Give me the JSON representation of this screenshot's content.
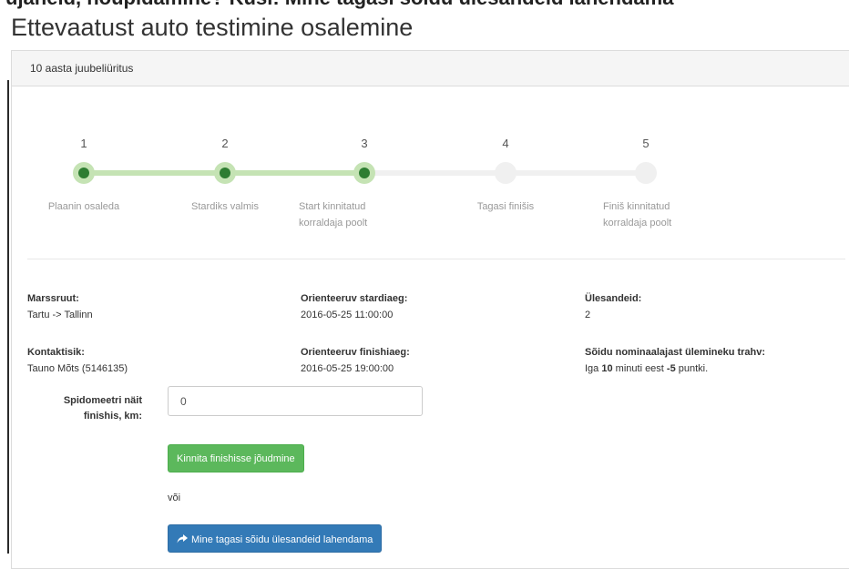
{
  "top_strip": {
    "text": "ujaneid, nõupidamine? Küsi:  Mine tagasi sõidu ülesandeid lahendama"
  },
  "page": {
    "title": "Ettevaatust auto testimine osalemine"
  },
  "panel": {
    "heading": "10 aasta juubeliüritus"
  },
  "steps": [
    {
      "num": "1",
      "label": "Plaanin osaleda",
      "status": "done"
    },
    {
      "num": "2",
      "label": "Stardiks valmis",
      "status": "done"
    },
    {
      "num": "3",
      "label": "Start kinnitatud korraldaja poolt",
      "status": "done"
    },
    {
      "num": "4",
      "label": "Tagasi finišis",
      "status": "todo"
    },
    {
      "num": "5",
      "label": "Finiš kinnitatud korraldaja poolt",
      "status": "todo"
    }
  ],
  "colors": {
    "done_track": "#c5e3b4",
    "todo_track": "#f0f0f0",
    "done_dot": "#2e7d32",
    "success": "#5cb85c",
    "primary": "#337ab7"
  },
  "info": {
    "route_label": "Marssruut:",
    "route_value": "Tartu -> Tallinn",
    "start_label": "Orienteeruv stardiaeg:",
    "start_value": "2016-05-25 11:00:00",
    "tasks_label": "Ülesandeid:",
    "tasks_value": "2",
    "contact_label": "Kontaktisik:",
    "contact_value": "Tauno Mõts (5146135)",
    "finish_label": "Orienteeruv finishiaeg:",
    "finish_value": "2016-05-25 19:00:00",
    "penalty_label": "Sõidu nominaalajast ülemineku trahv:",
    "penalty_prefix": "Iga ",
    "penalty_minutes": "10",
    "penalty_mid": " minuti eest ",
    "penalty_points": "-5",
    "penalty_suffix": " puntki."
  },
  "form": {
    "odometer_label": "Spidomeetri näit finishis, km:",
    "odometer_value": "0",
    "confirm_button": "Kinnita finishisse jõudmine",
    "or_text": "või",
    "back_button": "Mine tagasi sõidu ülesandeid lahendama",
    "back_icon": "share-icon"
  }
}
